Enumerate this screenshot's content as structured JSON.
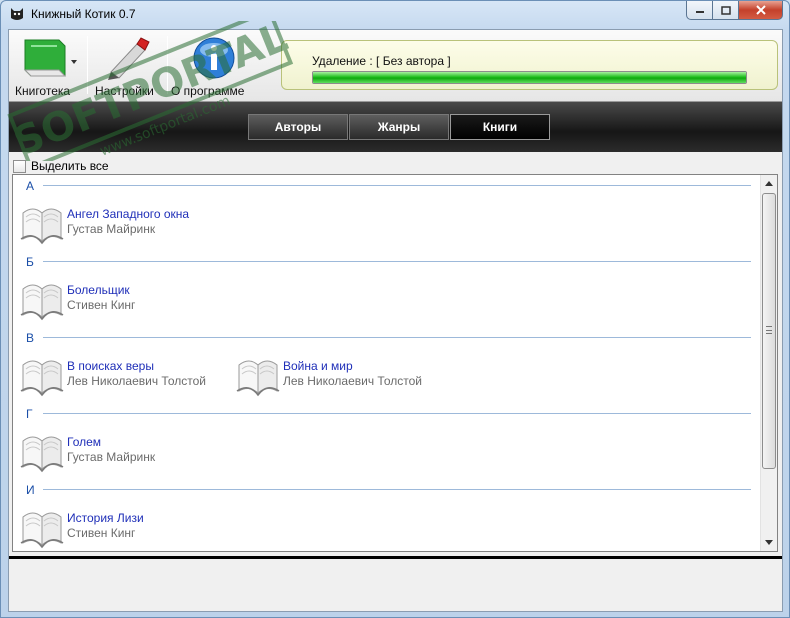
{
  "window": {
    "title": "Книжный Котик 0.7"
  },
  "toolbar": {
    "library_label": "Книготека",
    "settings_label": "Настройки",
    "about_label": "О программе"
  },
  "progress": {
    "label": "Удаление : [ Без автора ]",
    "percent": 100
  },
  "tabs": [
    {
      "label": "Авторы",
      "active": false
    },
    {
      "label": "Жанры",
      "active": false
    },
    {
      "label": "Книги",
      "active": true
    }
  ],
  "select_all": {
    "label": "Выделить все",
    "checked": false
  },
  "groups": [
    {
      "letter": "А",
      "books": [
        {
          "title": "Ангел Западного окна",
          "author": "Густав Майринк"
        }
      ]
    },
    {
      "letter": "Б",
      "books": [
        {
          "title": "Болельщик",
          "author": "Стивен Кинг"
        }
      ]
    },
    {
      "letter": "В",
      "books": [
        {
          "title": "В поисках веры",
          "author": "Лев Николаевич Толстой"
        },
        {
          "title": "Война и мир",
          "author": "Лев Николаевич Толстой"
        }
      ]
    },
    {
      "letter": "Г",
      "books": [
        {
          "title": "Голем",
          "author": "Густав Майринк"
        }
      ]
    },
    {
      "letter": "И",
      "books": [
        {
          "title": "История Лизи",
          "author": "Стивен Кинг"
        }
      ]
    }
  ],
  "watermark": {
    "brand": "SOFTPORTAL",
    "tm": "TM",
    "url": "www.softportal.com"
  },
  "colors": {
    "accent_link": "#1f2fb8",
    "group_letter": "#1b4fa8",
    "progress": "#1fbf1f",
    "tab_band": "#1c1c1c"
  }
}
